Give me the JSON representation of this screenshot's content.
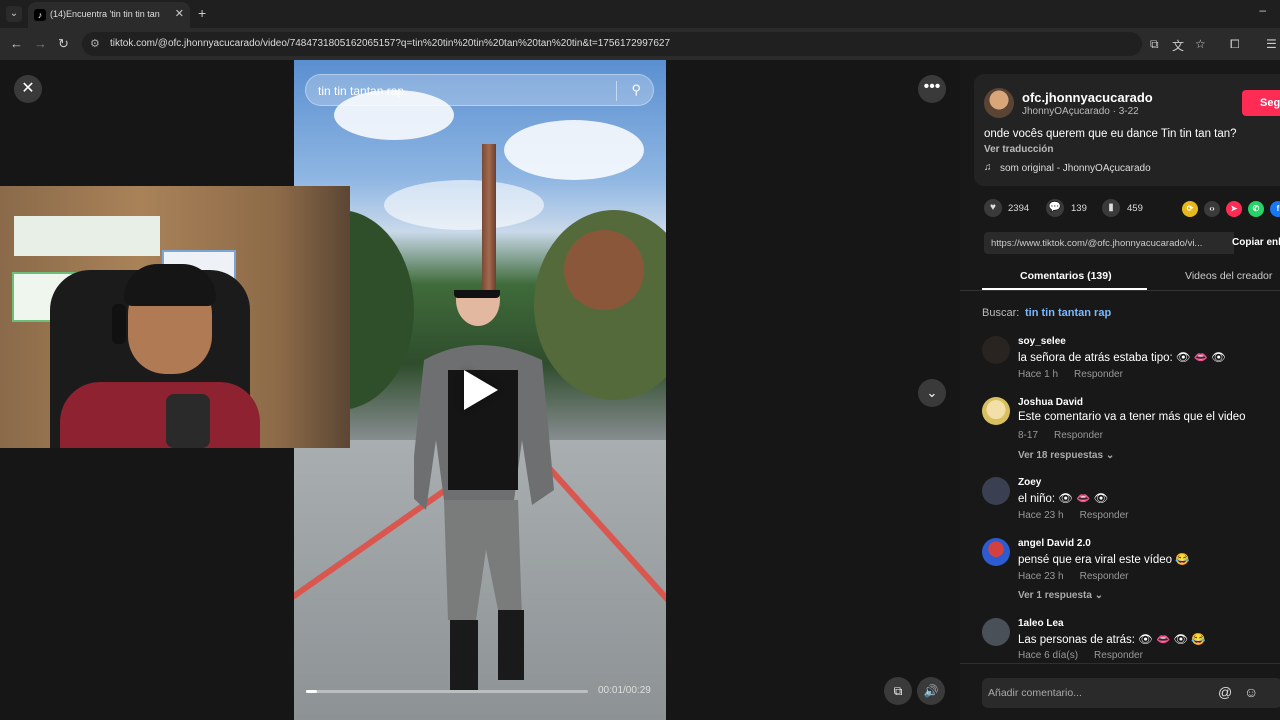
{
  "browser": {
    "tab_title": "(14)Encuentra 'tin tin tin tan",
    "url": "tiktok.com/@ofc.jhonnyacucarado/video/7484731805162065157?q=tin%20tin%20tin%20tan%20tan%20tin&t=1756172997627"
  },
  "video": {
    "search_text": "tin tin tantan rap",
    "time": "00:01/00:29",
    "progress": 0.04
  },
  "creator": {
    "username": "ofc.jhonnyacucarado",
    "subline": "JhonnyOAçucarado · 3-22",
    "follow_label": "Segu",
    "description": "onde vocês querem que eu dance Tin tin tan tan?",
    "translate_label": "Ver traducción",
    "music": "som original - JhonnyOAçucarado"
  },
  "stats": {
    "likes": "2394",
    "comments": "139",
    "saves": "459"
  },
  "share": {
    "link": "https://www.tiktok.com/@ofc.jhonnyacucarado/vi...",
    "copy_label": "Copiar enl"
  },
  "tabs": {
    "comments": "Comentarios (139)",
    "videos": "Videos del creador"
  },
  "search": {
    "label": "Buscar:",
    "term": "tin tin tantan rap"
  },
  "comments": [
    {
      "name": "soy_selee",
      "text": "la señora de atrás estaba tipo: 👁 👄 👁",
      "time": "Hace 1 h",
      "reply": "Responder",
      "more": "",
      "color": "#2a2420"
    },
    {
      "name": "Joshua David",
      "text": "Este comentario va a tener más que el video",
      "time": "8-17",
      "reply": "Responder",
      "more": "Ver 18 respuestas ⌄",
      "color": "#e8d77a"
    },
    {
      "name": "Zoey",
      "text": "el niño: 👁 👄 👁",
      "time": "Hace 23 h",
      "reply": "Responder",
      "more": "",
      "color": "#3a3f52"
    },
    {
      "name": "angel David 2.0",
      "text": "pensé que era viral este vídeo 😂",
      "time": "Hace 23 h",
      "reply": "Responder",
      "more": "Ver 1 respuesta ⌄",
      "color": "#2d5bd1"
    },
    {
      "name": "1aleo Lea",
      "text": "Las personas de atrás: 👁 👄 👁 😂",
      "time": "Hace 6 día(s)",
      "reply": "Responder",
      "more": "",
      "color": "#4a5058"
    }
  ],
  "comment_input": {
    "placeholder": "Añadir comentario..."
  }
}
